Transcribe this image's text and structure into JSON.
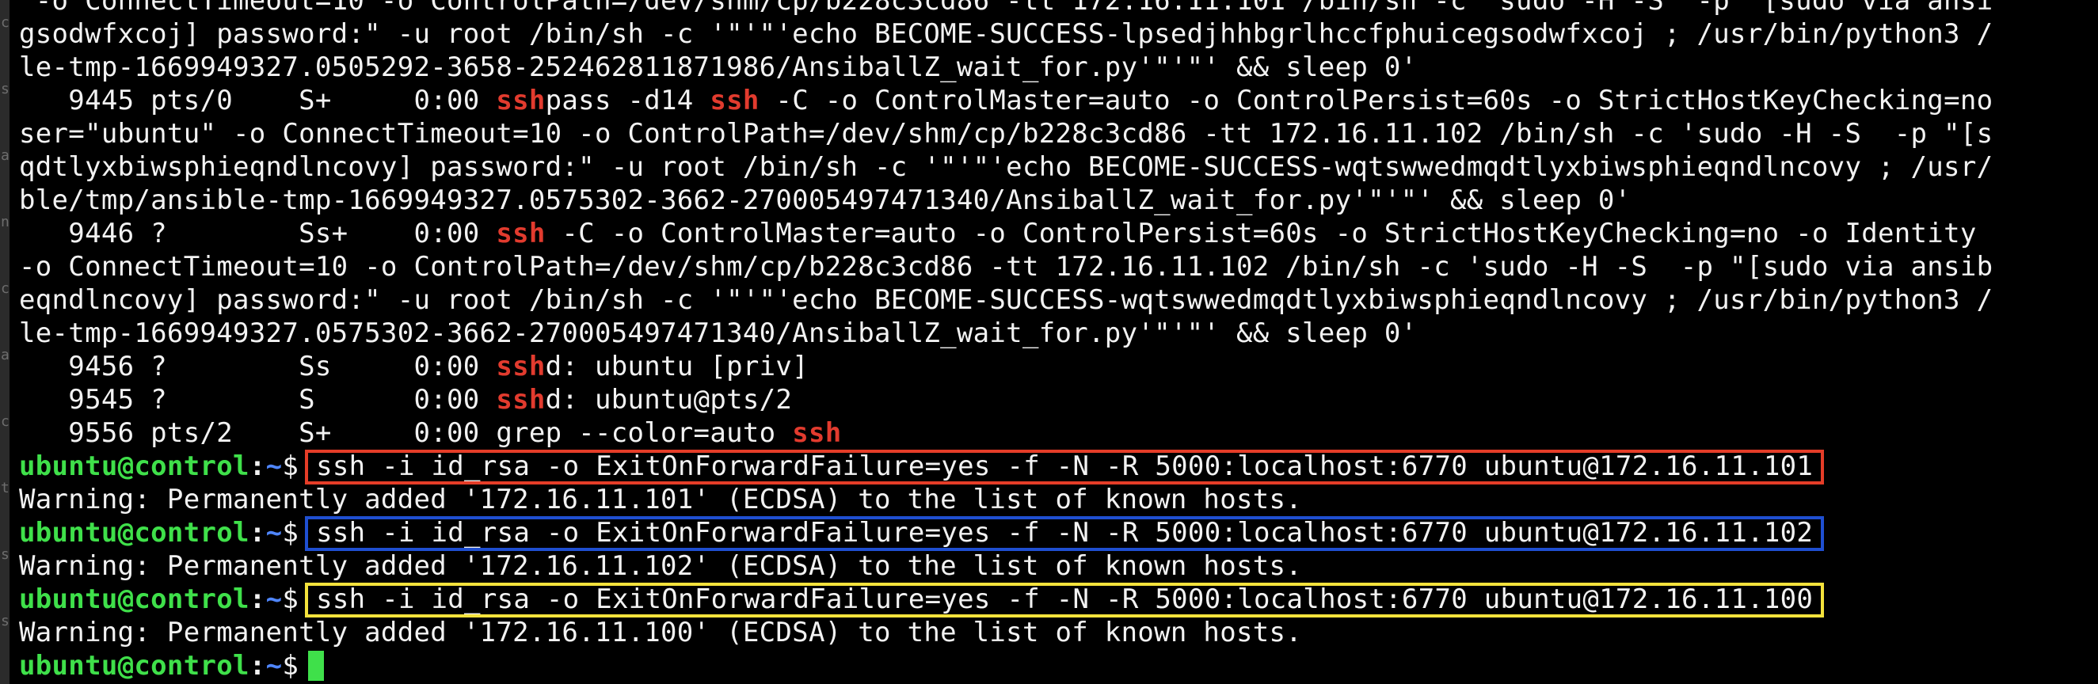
{
  "terminal": {
    "lines": [
      {
        "type": "plain",
        "text": " -o ConnectTimeout=10 -o ControlPath=/dev/shm/cp/b228c3cd86 -tt 172.16.11.101 /bin/sh -c 'sudo -H -S  -p \"[sudo via ansi"
      },
      {
        "type": "plain",
        "text": "gsodwfxcoj] password:\" -u root /bin/sh -c '\"'\"'echo BECOME-SUCCESS-lpsedjhhbgrlhccfphuicegsodwfxcoj ; /usr/bin/python3 /"
      },
      {
        "type": "plain",
        "text": "le-tmp-1669949327.0505292-3658-252462811871986/AnsiballZ_wait_for.py'\"'\"' && sleep 0'"
      },
      {
        "type": "ps_sshpass",
        "prefix": "   9445 pts/0    S+     0:00 ",
        "hl1": "ssh",
        "mid1": "pass -d14 ",
        "hl2": "ssh",
        "rest": " -C -o ControlMaster=auto -o ControlPersist=60s -o StrictHostKeyChecking=no"
      },
      {
        "type": "plain",
        "text": "ser=\"ubuntu\" -o ConnectTimeout=10 -o ControlPath=/dev/shm/cp/b228c3cd86 -tt 172.16.11.102 /bin/sh -c 'sudo -H -S  -p \"[s"
      },
      {
        "type": "plain",
        "text": "qdtlyxbiwsphieqndlncovy] password:\" -u root /bin/sh -c '\"'\"'echo BECOME-SUCCESS-wqtswwedmqdtlyxbiwsphieqndlncovy ; /usr/"
      },
      {
        "type": "plain",
        "text": "ble/tmp/ansible-tmp-1669949327.0575302-3662-270005497471340/AnsiballZ_wait_for.py'\"'\"' && sleep 0'"
      },
      {
        "type": "ps",
        "prefix": "   9446 ?        Ss+    0:00 ",
        "hl": "ssh",
        "rest": " -C -o ControlMaster=auto -o ControlPersist=60s -o StrictHostKeyChecking=no -o Identity"
      },
      {
        "type": "plain",
        "text": "-o ConnectTimeout=10 -o ControlPath=/dev/shm/cp/b228c3cd86 -tt 172.16.11.102 /bin/sh -c 'sudo -H -S  -p \"[sudo via ansib"
      },
      {
        "type": "plain",
        "text": "eqndlncovy] password:\" -u root /bin/sh -c '\"'\"'echo BECOME-SUCCESS-wqtswwedmqdtlyxbiwsphieqndlncovy ; /usr/bin/python3 /"
      },
      {
        "type": "plain",
        "text": "le-tmp-1669949327.0575302-3662-270005497471340/AnsiballZ_wait_for.py'\"'\"' && sleep 0'"
      },
      {
        "type": "ps",
        "prefix": "   9456 ?        Ss     0:00 ",
        "hl": "ssh",
        "rest": "d: ubuntu [priv]"
      },
      {
        "type": "ps",
        "prefix": "   9545 ?        S      0:00 ",
        "hl": "ssh",
        "rest": "d: ubuntu@pts/2"
      },
      {
        "type": "ps",
        "prefix": "   9556 pts/2    S+     0:00 grep --color=auto ",
        "hl": "ssh",
        "rest": ""
      },
      {
        "type": "cmd",
        "box": "red",
        "command": "ssh -i id_rsa -o ExitOnForwardFailure=yes -f -N -R 5000:localhost:6770 ubuntu@172.16.11.101"
      },
      {
        "type": "plain",
        "text": "Warning: Permanently added '172.16.11.101' (ECDSA) to the list of known hosts."
      },
      {
        "type": "cmd",
        "box": "blue",
        "command": "ssh -i id_rsa -o ExitOnForwardFailure=yes -f -N -R 5000:localhost:6770 ubuntu@172.16.11.102"
      },
      {
        "type": "plain",
        "text": "Warning: Permanently added '172.16.11.102' (ECDSA) to the list of known hosts."
      },
      {
        "type": "cmd",
        "box": "yellow",
        "command": "ssh -i id_rsa -o ExitOnForwardFailure=yes -f -N -R 5000:localhost:6770 ubuntu@172.16.11.100"
      },
      {
        "type": "plain",
        "text": "Warning: Permanently added '172.16.11.100' (ECDSA) to the list of known hosts."
      },
      {
        "type": "prompt_cursor"
      }
    ],
    "prompt": {
      "user_host": "ubuntu@control",
      "colon": ":",
      "path": "~",
      "dollar": "$"
    },
    "colors": {
      "background": "#000000",
      "text": "#f2f2f2",
      "highlight": "#e23b2e",
      "prompt_user": "#3fe04a",
      "prompt_path": "#4f86ff",
      "box_red": "#e53d28",
      "box_blue": "#1f4fd1",
      "box_yellow": "#f4e23c",
      "cursor": "#3fe04a"
    }
  },
  "side_strip": {
    "glyphs": [
      "c",
      "s",
      "a",
      "n",
      "c",
      "a",
      "c",
      "t",
      "s",
      "s"
    ]
  }
}
